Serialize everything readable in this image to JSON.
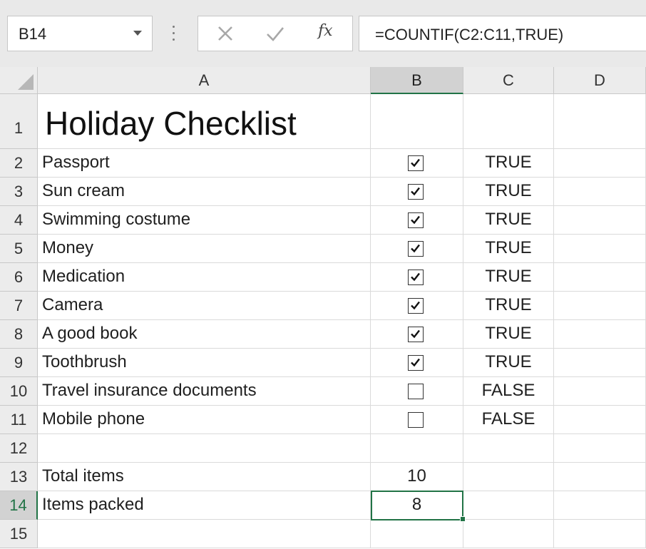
{
  "formula_bar": {
    "name_box": "B14",
    "formula": "=COUNTIF(C2:C11,TRUE)",
    "fx_label": "fx",
    "icons": [
      "cancel-icon",
      "enter-icon",
      "insert-function-icon"
    ]
  },
  "columns": [
    "A",
    "B",
    "C",
    "D"
  ],
  "selected_column": "B",
  "selected_row": "14",
  "rows": [
    {
      "num": "1",
      "a": "Holiday Checklist",
      "b": "",
      "c": ""
    },
    {
      "num": "2",
      "a": "Passport",
      "checked": true,
      "c": "TRUE"
    },
    {
      "num": "3",
      "a": "Sun cream",
      "checked": true,
      "c": "TRUE"
    },
    {
      "num": "4",
      "a": "Swimming costume",
      "checked": true,
      "c": "TRUE"
    },
    {
      "num": "5",
      "a": "Money",
      "checked": true,
      "c": "TRUE"
    },
    {
      "num": "6",
      "a": "Medication",
      "checked": true,
      "c": "TRUE"
    },
    {
      "num": "7",
      "a": "Camera",
      "checked": true,
      "c": "TRUE"
    },
    {
      "num": "8",
      "a": "A good book",
      "checked": true,
      "c": "TRUE"
    },
    {
      "num": "9",
      "a": "Toothbrush",
      "checked": true,
      "c": "TRUE"
    },
    {
      "num": "10",
      "a": "Travel insurance documents",
      "checked": false,
      "c": "FALSE"
    },
    {
      "num": "11",
      "a": "Mobile phone",
      "checked": false,
      "c": "FALSE"
    },
    {
      "num": "12",
      "a": "",
      "b": "",
      "c": ""
    },
    {
      "num": "13",
      "a": "Total items",
      "b": "10",
      "c": ""
    },
    {
      "num": "14",
      "a": "Items packed",
      "b": "8",
      "c": ""
    },
    {
      "num": "15",
      "a": "",
      "b": "",
      "c": ""
    }
  ],
  "colors": {
    "accent": "#217346",
    "header_bg": "#ececec",
    "header_selected_bg": "#d2d2d2",
    "gridline": "#dadada"
  }
}
